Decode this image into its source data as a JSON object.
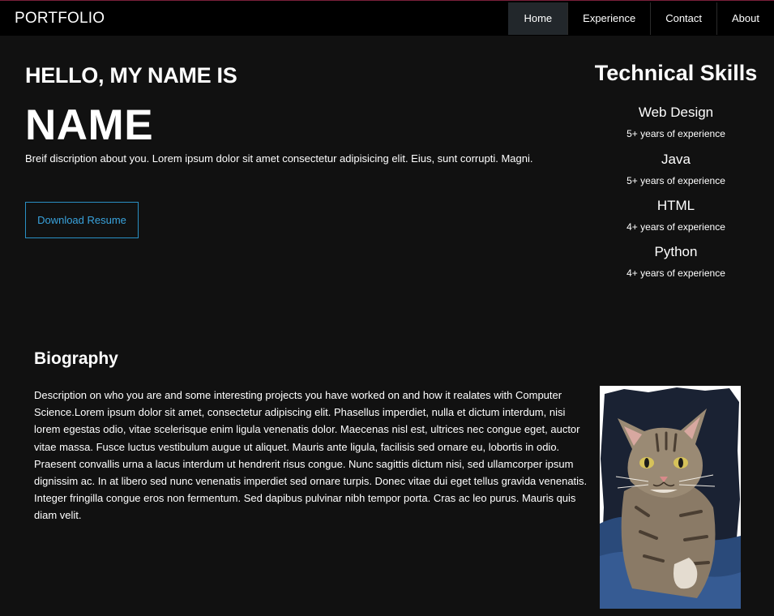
{
  "nav": {
    "brand": "PORTFOLIO",
    "links": [
      "Home",
      "Experience",
      "Contact",
      "About"
    ],
    "active": "Home"
  },
  "hero": {
    "greeting": "HELLO, MY NAME IS",
    "name": "NAME",
    "brief": "Breif discription about you. Lorem ipsum dolor sit amet consectetur adipisicing elit. Eius, sunt corrupti. Magni.",
    "resume_button": "Download Resume"
  },
  "skills": {
    "title": "Technical Skills",
    "items": [
      {
        "name": "Web Design",
        "experience": "5+ years of experience"
      },
      {
        "name": "Java",
        "experience": "5+ years of experience"
      },
      {
        "name": "HTML",
        "experience": "4+ years of experience"
      },
      {
        "name": "Python",
        "experience": "4+ years of experience"
      }
    ]
  },
  "biography": {
    "title": "Biography",
    "text": "Description on who you are and some interesting projects you have worked on and how it realates with Computer Science.Lorem ipsum dolor sit amet, consectetur adipiscing elit. Phasellus imperdiet, nulla et dictum interdum, nisi lorem egestas odio, vitae scelerisque enim ligula venenatis dolor. Maecenas nisl est, ultrices nec congue eget, auctor vitae massa. Fusce luctus vestibulum augue ut aliquet. Mauris ante ligula, facilisis sed ornare eu, lobortis in odio. Praesent convallis urna a lacus interdum ut hendrerit risus congue. Nunc sagittis dictum nisi, sed ullamcorper ipsum dignissim ac. In at libero sed nunc venenatis imperdiet sed ornare turpis. Donec vitae dui eget tellus gravida venenatis. Integer fringilla congue eros non fermentum. Sed dapibus pulvinar nibh tempor porta. Cras ac leo purus. Mauris quis diam velit."
  },
  "colors": {
    "background": "#111111",
    "navbar": "#000000",
    "accent": "#39a3dd",
    "nav_active": "#22272b"
  }
}
